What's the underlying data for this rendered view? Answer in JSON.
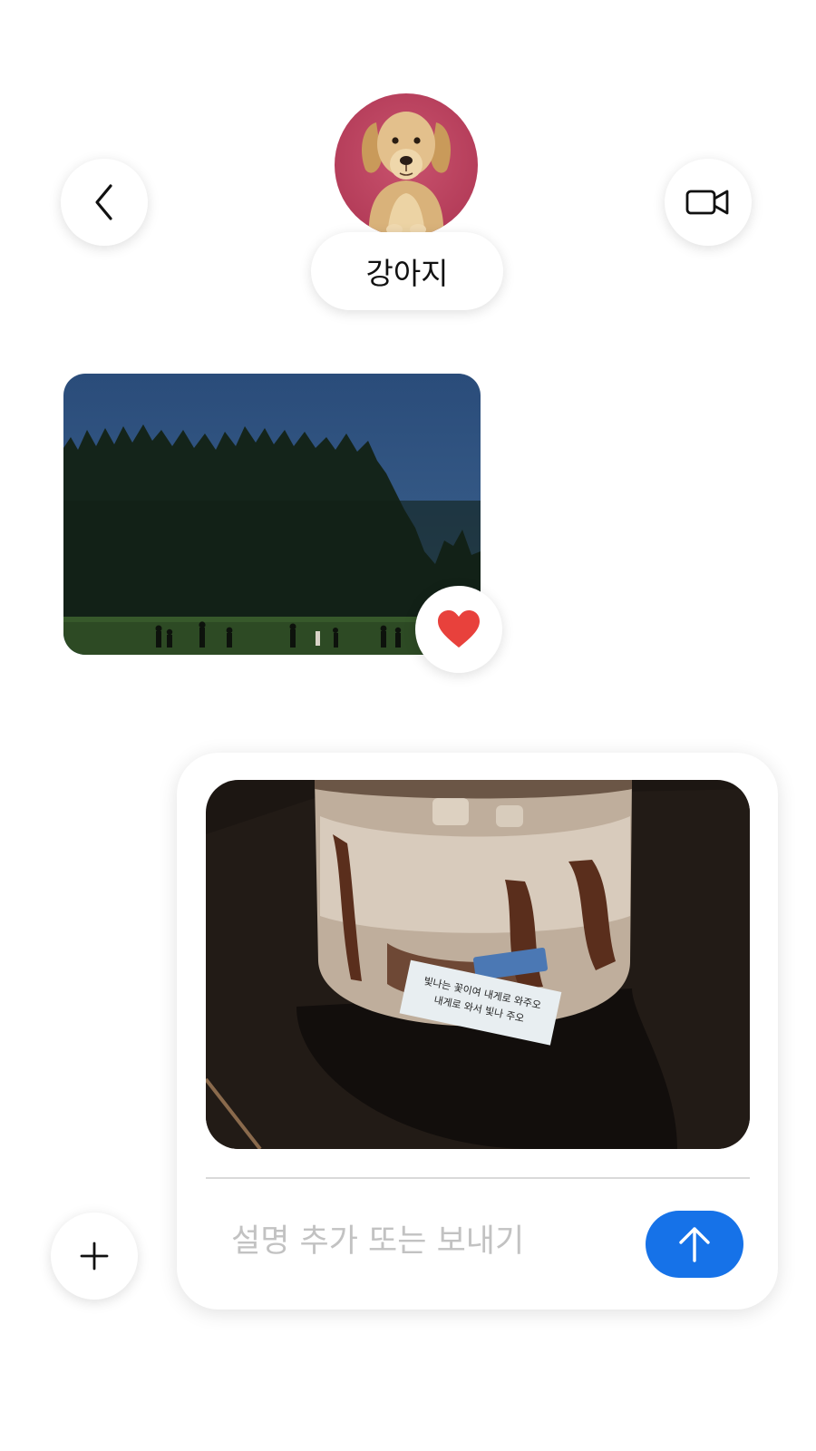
{
  "header": {
    "contact_name": "강아지",
    "back_icon": "chevron-left-icon",
    "video_icon": "video-camera-icon"
  },
  "messages": [
    {
      "type": "photo",
      "direction": "received",
      "subject": "forest-at-dusk",
      "reaction": "heart",
      "reaction_color": "#e8413c"
    }
  ],
  "composer": {
    "attachment_subject": "iced-mocha-cup",
    "attachment_note_line1": "빛나는 꽃이여 내게로 와주오",
    "attachment_note_line2": "내게로 와서 빛나 주오",
    "caption_placeholder": "설명 추가 또는 보내기",
    "caption_value": "",
    "send_icon": "arrow-up-icon",
    "send_color": "#1672e8",
    "add_icon": "plus-icon"
  }
}
